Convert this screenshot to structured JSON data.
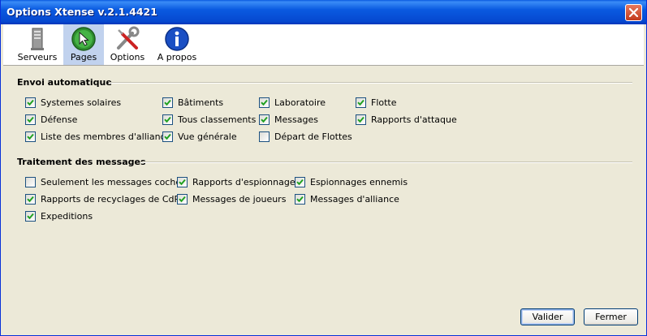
{
  "window": {
    "title": "Options Xtense v.2.1.4421"
  },
  "toolbar": {
    "items": [
      {
        "label": "Serveurs",
        "icon": "server-icon"
      },
      {
        "label": "Pages",
        "icon": "cursor-arrow-icon",
        "selected": true
      },
      {
        "label": "Options",
        "icon": "tools-icon"
      },
      {
        "label": "A propos",
        "icon": "info-icon"
      }
    ]
  },
  "envoi": {
    "title": "Envoi automatique",
    "items": [
      {
        "label": "Systemes solaires",
        "checked": true
      },
      {
        "label": "Défense",
        "checked": true
      },
      {
        "label": "Liste des membres d'alliance",
        "checked": true
      },
      {
        "label": "Bâtiments",
        "checked": true
      },
      {
        "label": "Tous classements",
        "checked": true
      },
      {
        "label": "Vue générale",
        "checked": true
      },
      {
        "label": "Laboratoire",
        "checked": true
      },
      {
        "label": "Messages",
        "checked": true
      },
      {
        "label": "Départ de Flottes",
        "checked": false
      },
      {
        "label": "Flotte",
        "checked": true
      },
      {
        "label": "Rapports d'attaque",
        "checked": true
      }
    ]
  },
  "messages": {
    "title": "Traitement des messages",
    "items": [
      {
        "label": "Seulement les messages cochés",
        "checked": false
      },
      {
        "label": "Rapports de recyclages de CdR",
        "checked": true
      },
      {
        "label": "Expeditions",
        "checked": true
      },
      {
        "label": "Rapports d'espionnage",
        "checked": true
      },
      {
        "label": "Messages de joueurs",
        "checked": true
      },
      {
        "label": "Espionnages ennemis",
        "checked": true
      },
      {
        "label": "Messages d'alliance",
        "checked": true
      }
    ]
  },
  "buttons": {
    "ok": "Valider",
    "close": "Fermer"
  },
  "colors": {
    "titlebar": "#0a5ae0",
    "checkmark": "#21a121",
    "selected_tab": "#c1d2ee"
  }
}
